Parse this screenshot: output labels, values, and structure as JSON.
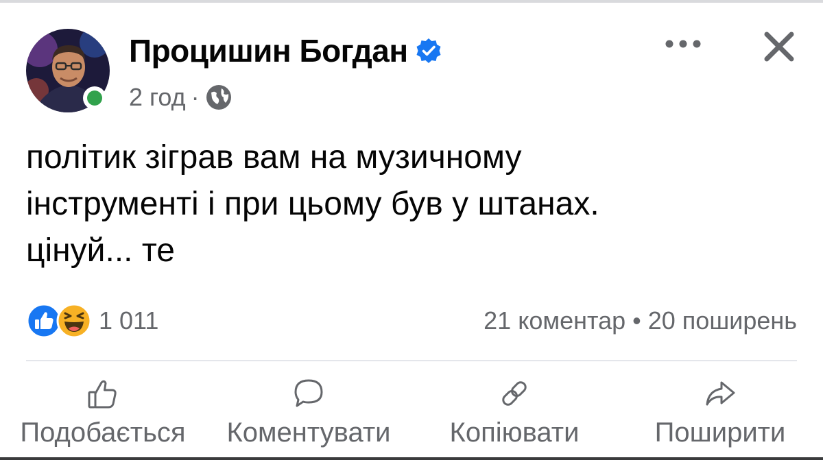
{
  "post": {
    "author": "Процишин Богдан",
    "time": "2 год",
    "separator": "·",
    "text_lines": [
      "політик зіграв вам на музичному",
      "інструменті і при цьому був у штанах.",
      "цінуй... те"
    ]
  },
  "reactions": {
    "icons": [
      "like-reaction-icon",
      "haha-reaction-icon"
    ],
    "count": "1 011"
  },
  "stats": {
    "comments": "21 коментар",
    "separator": "•",
    "shares": "20 поширень"
  },
  "actions": {
    "like": "Подобається",
    "comment": "Коментувати",
    "copy": "Копіювати",
    "share": "Поширити"
  },
  "colors": {
    "accent": "#1877f2",
    "secondary_text": "#65676b",
    "online": "#31a24c",
    "haha": "#f7b125"
  }
}
